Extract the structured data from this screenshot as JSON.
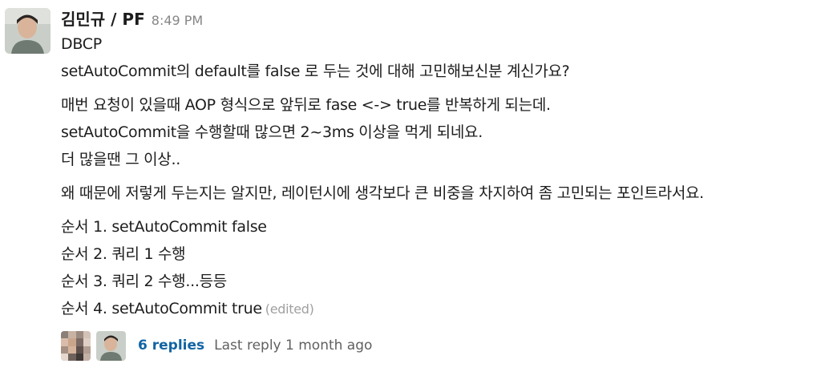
{
  "message": {
    "sender": "김민규 / PF",
    "timestamp": "8:49 PM",
    "paragraphs": [
      [
        "DBCP",
        "setAutoCommit의 default를 false 로 두는 것에 대해 고민해보신분 계신가요?"
      ],
      [
        "매번 요청이 있을때 AOP 형식으로 앞뒤로 fase <-> true를 반복하게 되는데.",
        "setAutoCommit을 수행할때 많으면 2~3ms 이상을 먹게 되네요.",
        "더 많을땐 그 이상.."
      ],
      [
        "왜 때문에 저렇게 두는지는 알지만, 레이턴시에 생각보다 큰 비중을 차지하여 좀 고민되는 포인트라서요."
      ],
      [
        "순서 1. setAutoCommit false",
        "순서 2.  쿼리 1 수행",
        "순서 3.  쿼리 2 수행...등등",
        "순서 4. setAutoCommit true"
      ]
    ],
    "edited_label": "(edited)"
  },
  "thread": {
    "reply_count": "6 replies",
    "last_reply": "Last reply 1 month ago"
  }
}
